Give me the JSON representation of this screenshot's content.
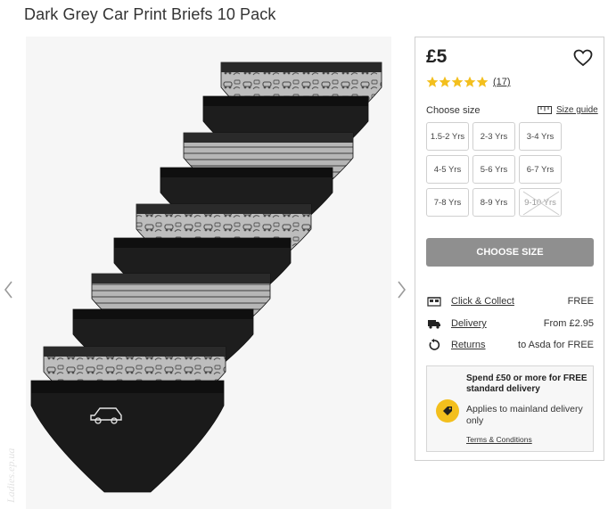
{
  "page": {
    "title": "Dark Grey Car Print Briefs 10 Pack"
  },
  "gallery": {
    "prev_icon": "chevron-left-icon",
    "next_icon": "chevron-right-icon",
    "watermark": "Ladies.ep.ua"
  },
  "product": {
    "price": "£5",
    "rating": {
      "stars": 5,
      "max": 5,
      "reviews": "(17)",
      "star_color": "#f3bf1d"
    },
    "choose_size_label": "Choose size",
    "size_guide_label": "Size guide",
    "sizes": [
      {
        "label": "1.5-2 Yrs",
        "available": true
      },
      {
        "label": "2-3 Yrs",
        "available": true
      },
      {
        "label": "3-4 Yrs",
        "available": true
      },
      {
        "label": "4-5 Yrs",
        "available": true
      },
      {
        "label": "5-6 Yrs",
        "available": true
      },
      {
        "label": "6-7 Yrs",
        "available": true
      },
      {
        "label": "7-8 Yrs",
        "available": true
      },
      {
        "label": "8-9 Yrs",
        "available": true
      },
      {
        "label": "9-10 Yrs",
        "available": false
      }
    ],
    "cta_label": "CHOOSE SIZE",
    "cta_color": "#8f8f8f"
  },
  "delivery": {
    "click_collect": {
      "label": "Click & Collect",
      "value": "FREE"
    },
    "delivery": {
      "label": "Delivery",
      "value": "From £2.95"
    },
    "returns": {
      "label": "Returns",
      "value": "to Asda for FREE"
    }
  },
  "promo": {
    "headline": "Spend £50 or more for FREE standard delivery",
    "body": "Applies to mainland delivery only",
    "terms": "Terms & Conditions",
    "badge_color": "#f3bf1d"
  }
}
